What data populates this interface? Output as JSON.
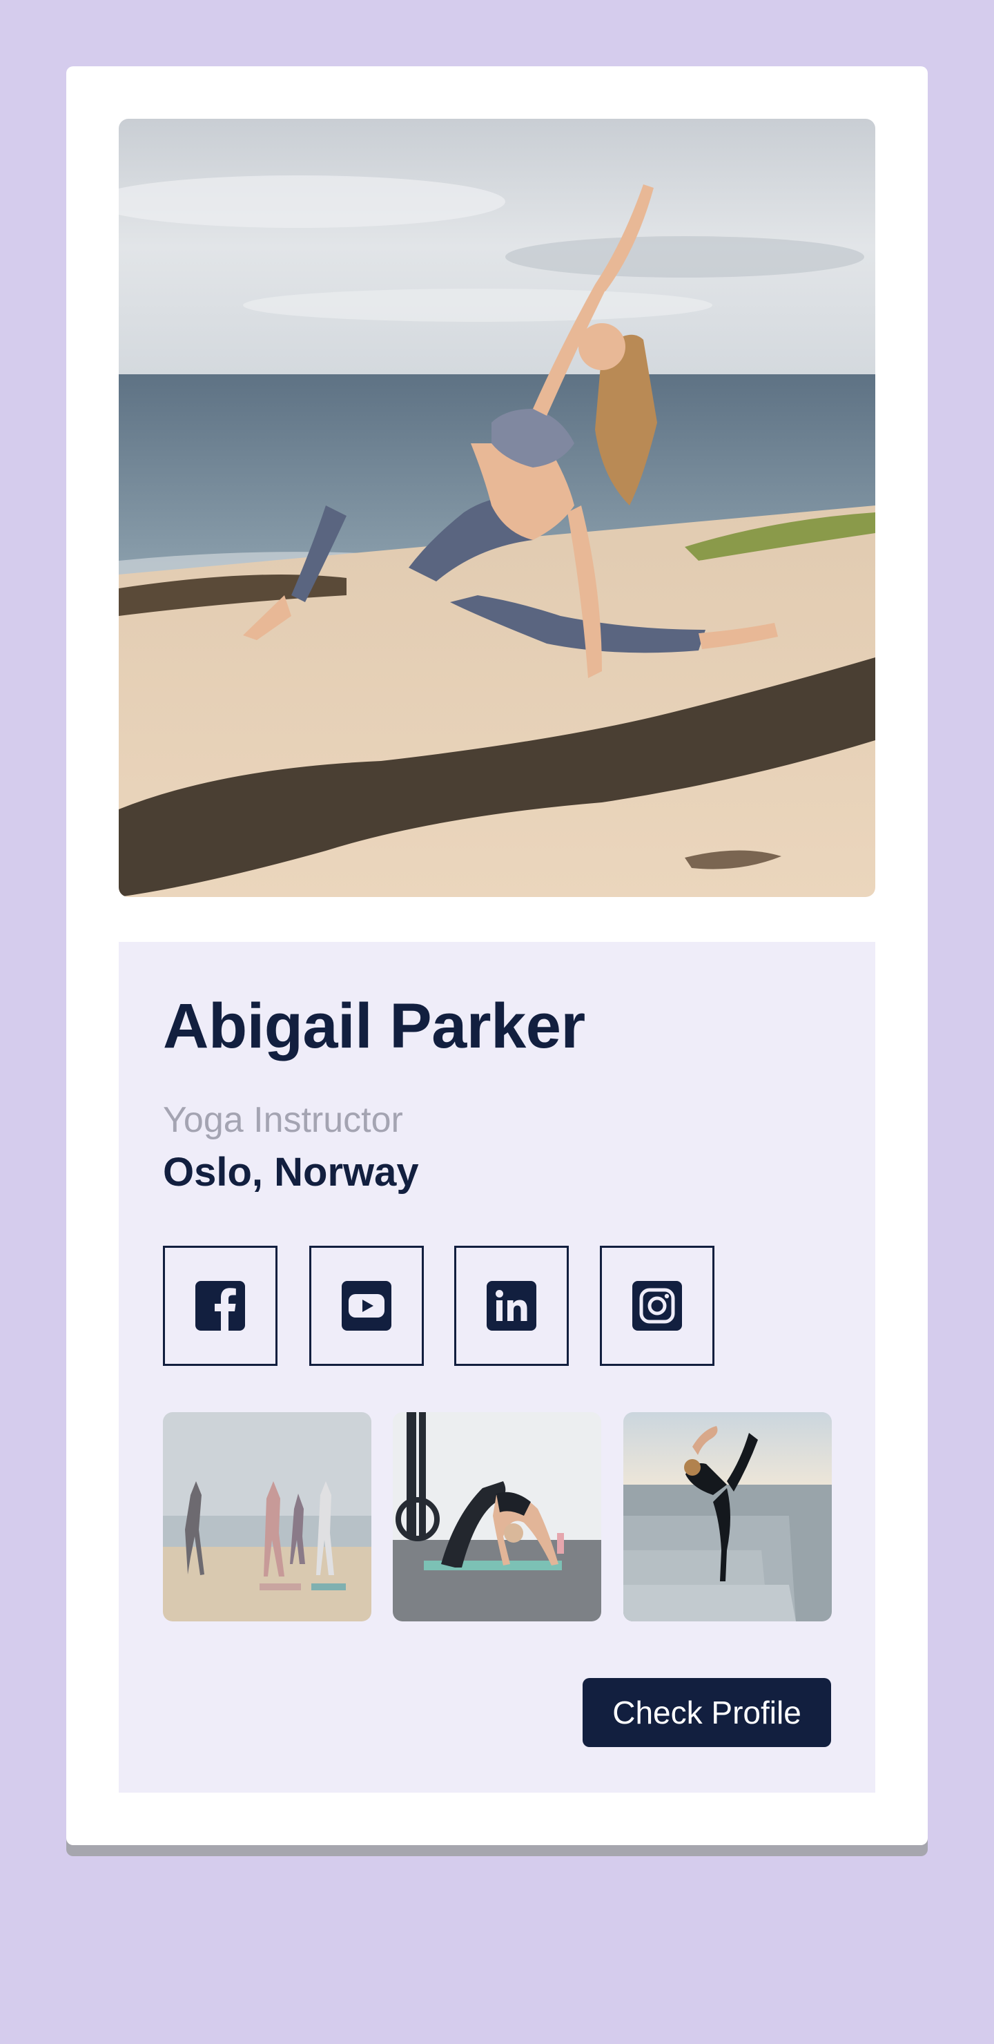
{
  "profile": {
    "name": "Abigail Parker",
    "role": "Yoga Instructor",
    "location": "Oslo, Norway"
  },
  "social": [
    {
      "icon": "facebook-icon"
    },
    {
      "icon": "youtube-icon"
    },
    {
      "icon": "linkedin-icon"
    },
    {
      "icon": "instagram-icon"
    }
  ],
  "actions": {
    "check_profile_label": "Check Profile"
  },
  "colors": {
    "page_background": "#d5cced",
    "card_background": "#ffffff",
    "info_panel_background": "#efedf9",
    "primary_navy": "#121f3f",
    "muted_text": "#a4a4b2"
  }
}
